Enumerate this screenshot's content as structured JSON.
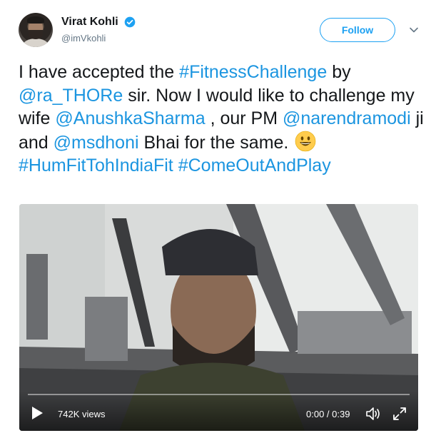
{
  "header": {
    "display_name": "Virat Kohli",
    "verified_icon": "verified-badge-icon",
    "handle": "@imVkohli",
    "follow_label": "Follow",
    "caret_icon": "chevron-down-icon"
  },
  "tweet": {
    "segments": [
      {
        "text": "I have accepted the ",
        "type": "text"
      },
      {
        "text": "#FitnessChallenge",
        "type": "link"
      },
      {
        "text": " by ",
        "type": "text"
      },
      {
        "text": "@ra_THORe",
        "type": "link"
      },
      {
        "text": " sir. Now I would like to challenge my wife ",
        "type": "text"
      },
      {
        "text": "@AnushkaSharma",
        "type": "link"
      },
      {
        "text": " , our PM ",
        "type": "text"
      },
      {
        "text": "@narendramodi",
        "type": "link"
      },
      {
        "text": " ji and ",
        "type": "text"
      },
      {
        "text": "@msdhoni",
        "type": "link"
      },
      {
        "text": " Bhai for the same. ",
        "type": "text"
      },
      {
        "text": "grinning-face-emoji",
        "type": "emoji"
      },
      {
        "text": " ",
        "type": "text"
      },
      {
        "text": "#HumFitTohIndiaFit",
        "type": "link"
      },
      {
        "text": " ",
        "type": "text"
      },
      {
        "text": "#ComeOutAndPlay",
        "type": "link"
      }
    ]
  },
  "video": {
    "views": "742K views",
    "time": "0:00 / 0:39",
    "play_icon": "play-icon",
    "volume_icon": "volume-icon",
    "fullscreen_icon": "fullscreen-icon",
    "progress": 0
  },
  "colors": {
    "link": "#1b95e0",
    "follow": "#1da1f2",
    "handle": "#657786"
  }
}
